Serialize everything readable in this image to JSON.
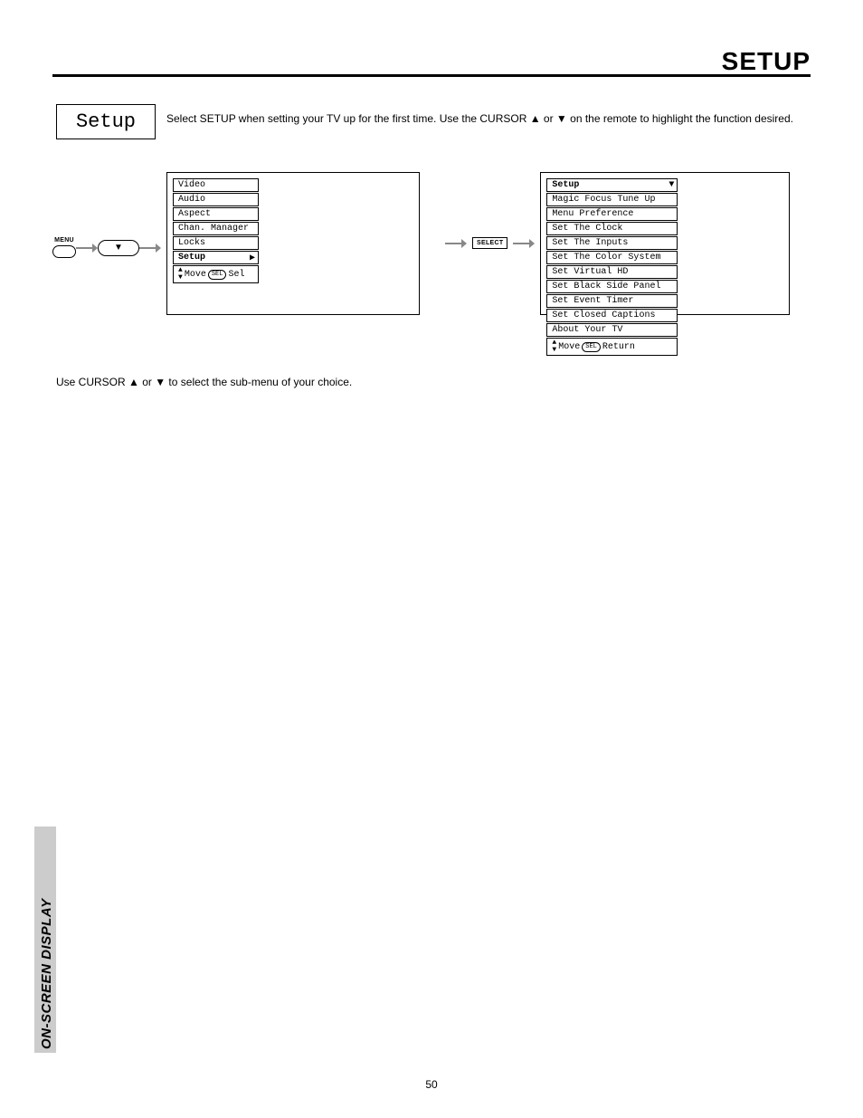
{
  "page_title": "SETUP",
  "section_title": "Setup",
  "intro": "Select SETUP when setting your TV up for the first time.  Use the CURSOR ▲ or ▼ on the remote to highlight the function desired.",
  "sub_text": "Use CURSOR ▲ or ▼ to select the sub-menu of your choice.",
  "remote": {
    "menu_label": "MENU",
    "select_label": "SELECT",
    "down_glyph": "▼"
  },
  "osd_main": {
    "items": [
      "Video",
      "Audio",
      "Aspect",
      "Chan. Manager",
      "Locks",
      "Setup"
    ],
    "selected_index": 5,
    "footer_move": "Move",
    "footer_sel_button": "SEL",
    "footer_sel": "Sel",
    "move_glyph": "▶",
    "down_glyph": "▼",
    "up_glyph": "▲"
  },
  "osd_setup": {
    "header": "Setup",
    "items": [
      "Magic Focus Tune Up",
      "Menu Preference",
      "Set The Clock",
      "Set The Inputs",
      "Set The Color System",
      "Set Virtual HD",
      "Set Black Side Panel",
      "Set Event Timer",
      "Set Closed Captions",
      "About Your TV"
    ],
    "footer_move": "Move",
    "footer_return_button": "SEL",
    "footer_return": "Return",
    "updown_glyph": "▲▼"
  },
  "side_tab": "ON-SCREEN DISPLAY",
  "page_number": "50"
}
